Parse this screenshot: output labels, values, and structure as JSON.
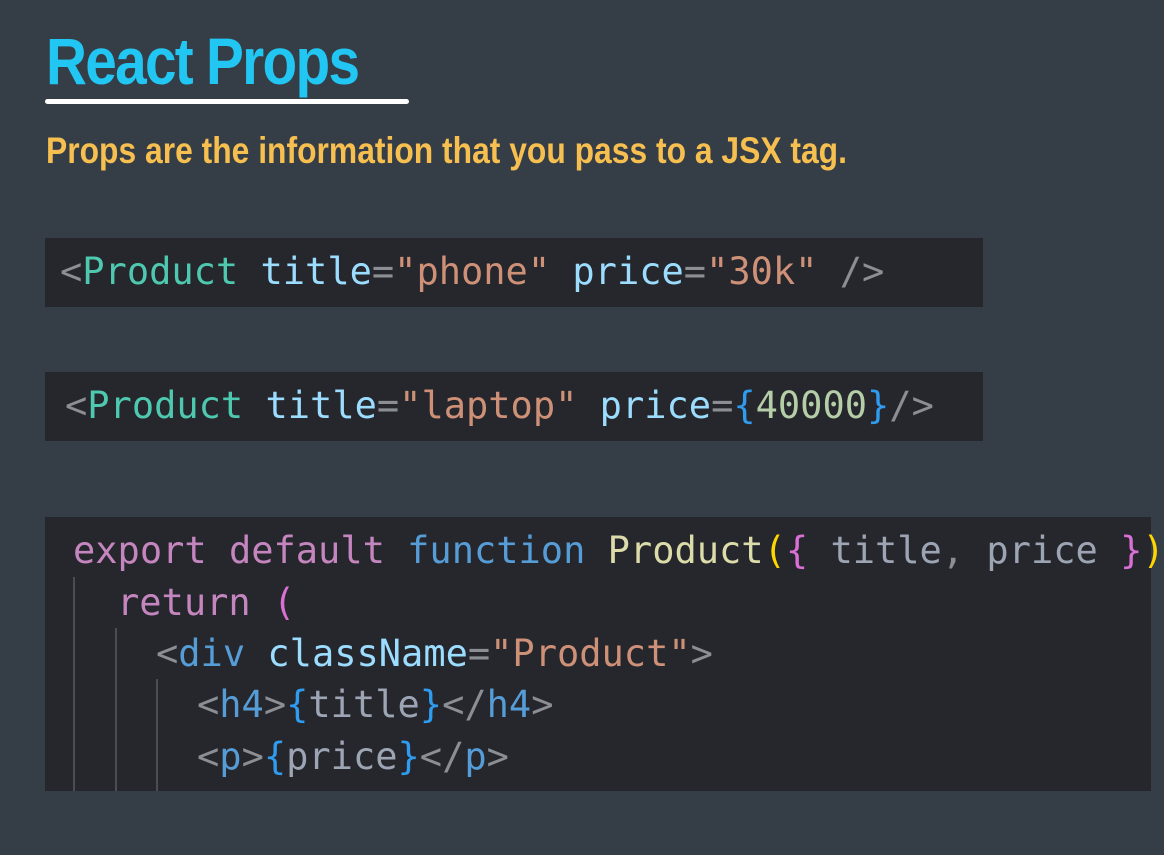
{
  "slide": {
    "title": "React Props",
    "subtitle": "Props are the information that you pass to a JSX tag."
  },
  "code1": {
    "open": "<",
    "component": "Product",
    "attr1": "title",
    "eq1": "=",
    "val1": "\"phone\"",
    "attr2": "price",
    "eq2": "=",
    "val2": "\"30k\"",
    "close": "/>"
  },
  "code2": {
    "open": "<",
    "component": "Product",
    "attr1": "title",
    "eq1": "=",
    "val1": "\"laptop\"",
    "attr2": "price",
    "eq2": "=",
    "brace_open": "{",
    "val2": "40000",
    "brace_close": "}",
    "close": "/>"
  },
  "code3": {
    "l1": {
      "export": "export",
      "default": "default",
      "function": "function",
      "name": "Product",
      "paren_open": "(",
      "brace_open": "{",
      "param1": "title",
      "comma": ",",
      "param2": "price",
      "brace_close": "}",
      "paren_close": ")",
      "body_open": "{"
    },
    "l2": {
      "return": "return",
      "paren_open": "("
    },
    "l3": {
      "open": "<",
      "tag": "div",
      "attr": "className",
      "eq": "=",
      "val": "\"Product\"",
      "close": ">"
    },
    "l4": {
      "open": "<",
      "tag": "h4",
      "gt": ">",
      "brace_open": "{",
      "expr": "title",
      "brace_close": "}",
      "close_open": "</",
      "close_tag": "h4",
      "close_gt": ">"
    },
    "l5": {
      "open": "<",
      "tag": "p",
      "gt": ">",
      "brace_open": "{",
      "expr": "price",
      "brace_close": "}",
      "close_open": "</",
      "close_tag": "p",
      "close_gt": ">"
    }
  },
  "colors": {
    "background": "#353d47",
    "title": "#22c6f2",
    "subtitle": "#f6bf4f",
    "code_background": "#25272c"
  }
}
